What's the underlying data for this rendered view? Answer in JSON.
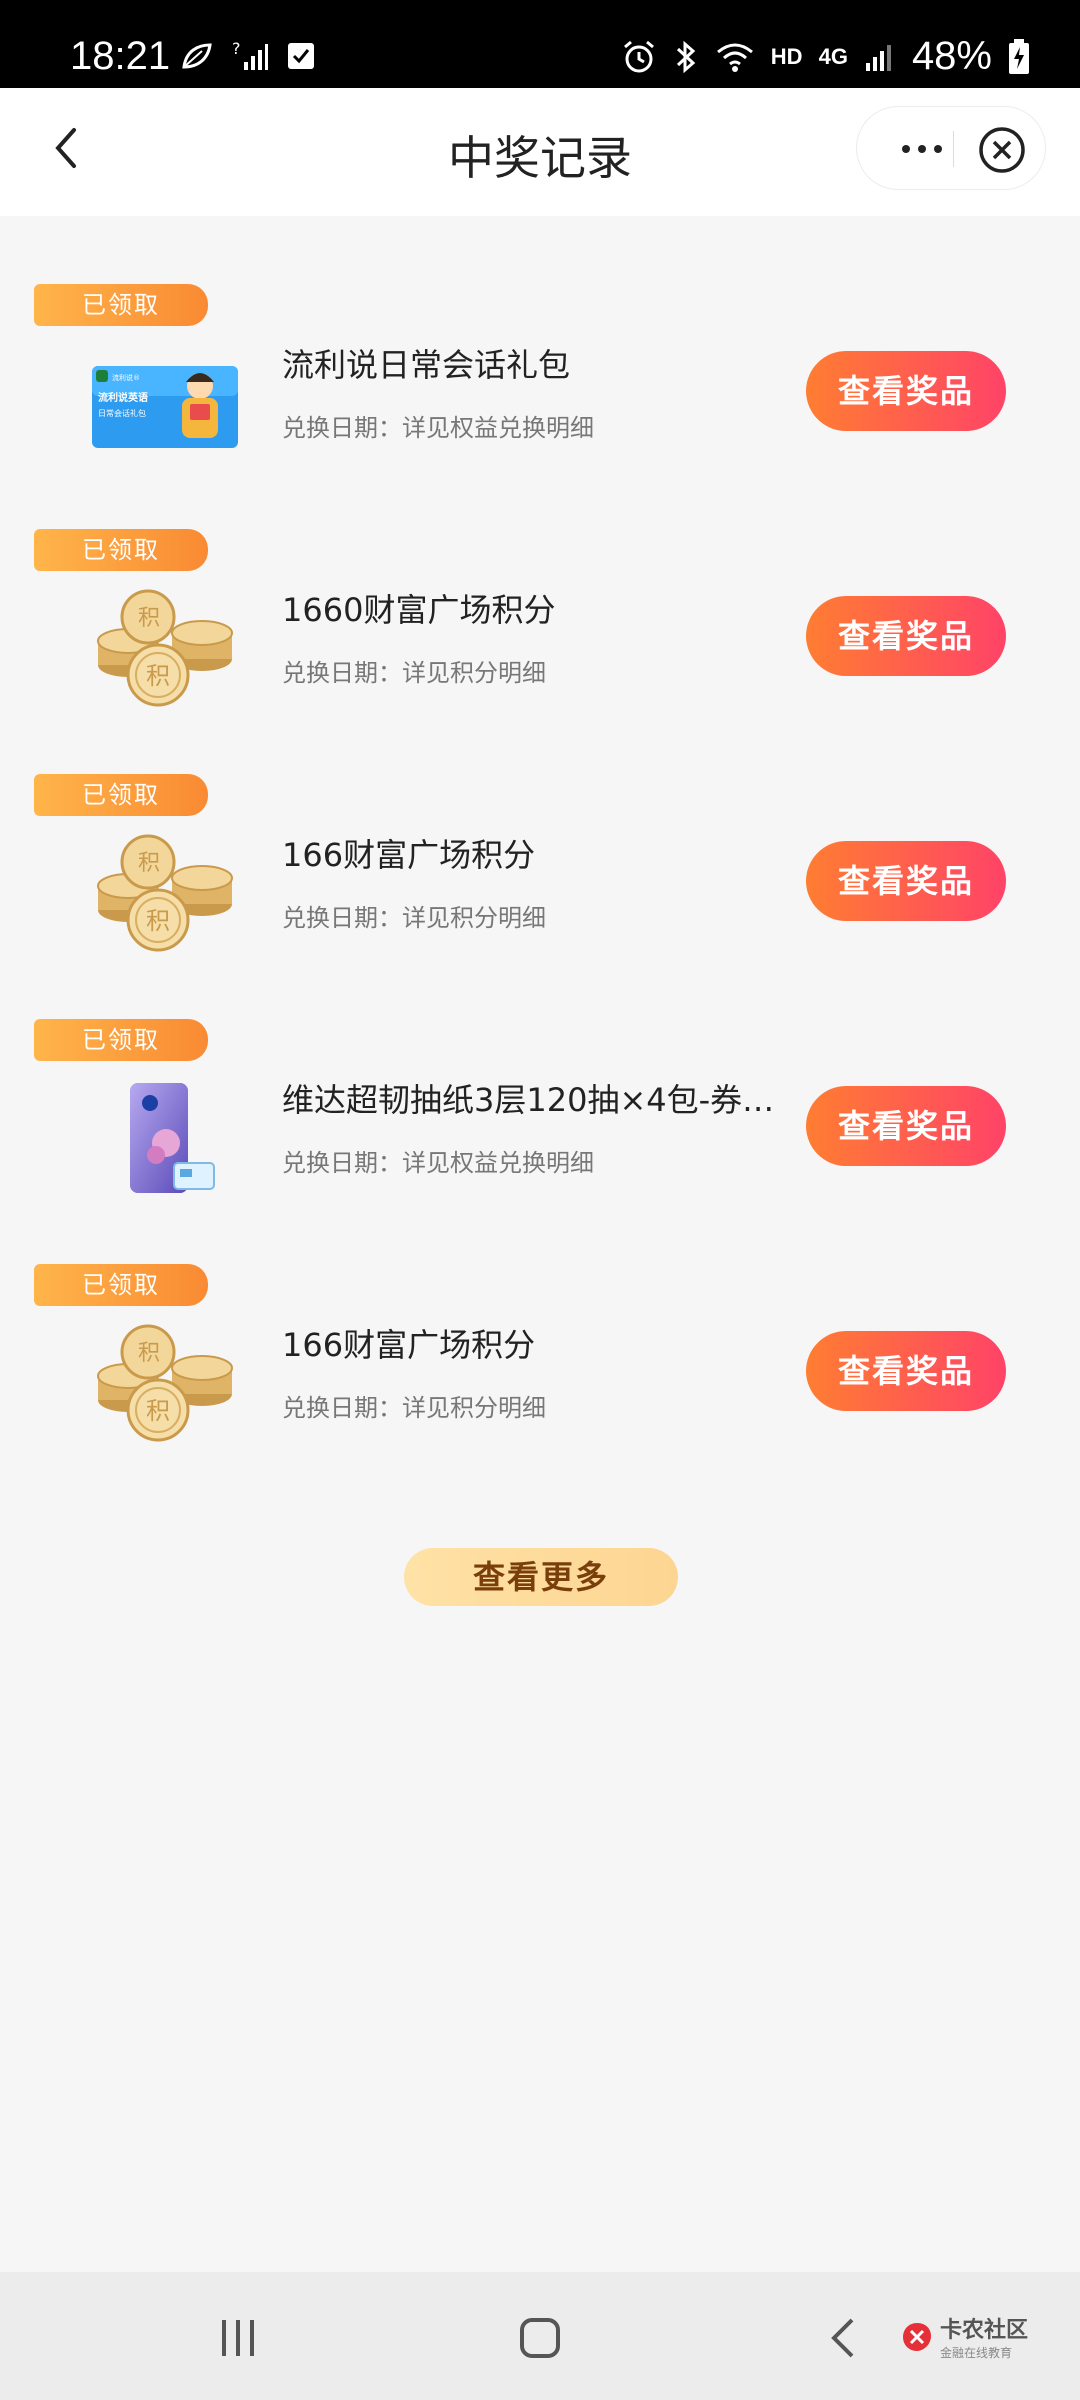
{
  "status_bar": {
    "time": "18:21",
    "network_label": "HD",
    "network_type": "4G",
    "battery": "48%"
  },
  "header": {
    "title": "中奖记录",
    "back_icon": "chevron-left-icon",
    "more_icon": "more-dots-icon",
    "close_icon": "close-circle-icon"
  },
  "records": [
    {
      "badge": "已领取",
      "title": "流利说日常会话礼包",
      "subtitle": "兑换日期：详见权益兑换明细",
      "button": "查看奖品",
      "thumb": "english-course-card",
      "thumb_card_title": "流利说英语",
      "thumb_card_sub": "日常会话礼包",
      "thumb_card_brand": "流利说®"
    },
    {
      "badge": "已领取",
      "title": "1660财富广场积分",
      "subtitle": "兑换日期：详见积分明细",
      "button": "查看奖品",
      "thumb": "gold-coins",
      "coin_char": "积"
    },
    {
      "badge": "已领取",
      "title": "166财富广场积分",
      "subtitle": "兑换日期：详见积分明细",
      "button": "查看奖品",
      "thumb": "gold-coins",
      "coin_char": "积"
    },
    {
      "badge": "已领取",
      "title": "维达超韧抽纸3层120抽×4包-券后...",
      "subtitle": "兑换日期：详见权益兑换明细",
      "button": "查看奖品",
      "thumb": "tissue-pack"
    },
    {
      "badge": "已领取",
      "title": "166财富广场积分",
      "subtitle": "兑换日期：详见积分明细",
      "button": "查看奖品",
      "thumb": "gold-coins",
      "coin_char": "积"
    }
  ],
  "load_more": "查看更多",
  "watermark": {
    "main": "卡农社区",
    "sub": "金融在线教育"
  },
  "colors": {
    "badge": "#f98a33",
    "button_start": "#ff7d32",
    "button_end": "#ff4367",
    "load_more_bg": "#ffe2a6",
    "load_more_text": "#7a3e0c",
    "background": "#f6f6f6"
  }
}
